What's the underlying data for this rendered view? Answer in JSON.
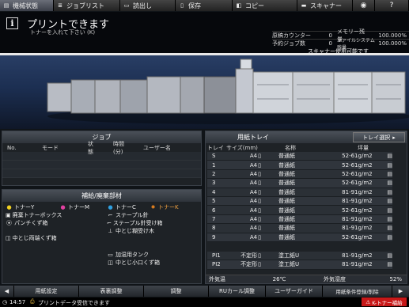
{
  "tabs": [
    {
      "label": "機械状態",
      "icon": "machine-status-icon",
      "active": true
    },
    {
      "label": "ジョブリスト",
      "icon": "job-list-icon",
      "active": false
    },
    {
      "label": "読出し",
      "icon": "retrieve-icon",
      "active": false
    },
    {
      "label": "保存",
      "icon": "save-icon",
      "active": false
    },
    {
      "label": "コピー",
      "icon": "copy-icon",
      "active": false
    },
    {
      "label": "スキャナー",
      "icon": "scanner-icon",
      "active": false
    }
  ],
  "status": {
    "title": "プリントできます",
    "subtitle": "トナーを入れて下さい (K)",
    "counters": [
      {
        "label": "原稿カウンター",
        "value": "0",
        "label2": "メモリー残量",
        "value2": "100.000%"
      },
      {
        "label": "予約ジョブ数",
        "value": "0",
        "label2": "ファイルシステム残量",
        "value2": "100.000%"
      }
    ],
    "scanner_status": "スキャナー使用可能です"
  },
  "jobs": {
    "title": "ジョブ",
    "columns": [
      "No.",
      "モード",
      "状態",
      "時間(分)",
      "ユーザー名"
    ]
  },
  "supplies": {
    "title": "補給/廃棄部材",
    "col1": [
      {
        "label": "トナーY",
        "color": "#f0d020",
        "icon": "toner-y-icon"
      },
      {
        "label": "廃棄トナーボックス",
        "color": "#cccccc",
        "icon": "waste-toner-box-icon"
      },
      {
        "label": "パンチくず箱",
        "color": "#cccccc",
        "icon": "punch-waste-icon"
      },
      {
        "label": "中とじ両端くず箱",
        "color": "#cccccc",
        "icon": "trim-waste-icon"
      }
    ],
    "col2": [
      {
        "label": "トナーM",
        "color": "#e040a0",
        "icon": "toner-m-icon"
      }
    ],
    "col3": [
      {
        "label": "トナーC",
        "color": "#30a0e0",
        "icon": "toner-c-icon"
      },
      {
        "label": "ステープル針",
        "color": "#cccccc",
        "icon": "staple-icon"
      },
      {
        "label": "ステープル針受け箱",
        "color": "#cccccc",
        "icon": "staple-waste-icon"
      },
      {
        "label": "中とじ糊受け木",
        "color": "#cccccc",
        "icon": "glue-tray-icon"
      },
      {
        "label": "加湿用タンク",
        "color": "#cccccc",
        "icon": "humidifier-tank-icon"
      },
      {
        "label": "中とじ小口くず箱",
        "color": "#cccccc",
        "icon": "fore-edge-waste-icon"
      }
    ],
    "col4": [
      {
        "label": "トナーK",
        "color": "#e08020",
        "icon": "toner-k-warning-icon"
      }
    ]
  },
  "trays": {
    "title": "用紙トレイ",
    "select_label": "トレイ選択",
    "columns": [
      "トレイ",
      "サイズ(mm)",
      "名称",
      "坪量"
    ],
    "rows": [
      {
        "tray": "S",
        "size": "A4",
        "name": "普通紙",
        "weight": "52-61g/m2"
      },
      {
        "tray": "1",
        "size": "A4",
        "name": "普通紙",
        "weight": "52-61g/m2"
      },
      {
        "tray": "2",
        "size": "A4",
        "name": "普通紙",
        "weight": "52-61g/m2"
      },
      {
        "tray": "3",
        "size": "A4",
        "name": "普通紙",
        "weight": "52-61g/m2"
      },
      {
        "tray": "4",
        "size": "A4",
        "name": "普通紙",
        "weight": "81-91g/m2"
      },
      {
        "tray": "5",
        "size": "A4",
        "name": "普通紙",
        "weight": "81-91g/m2"
      },
      {
        "tray": "6",
        "size": "A4",
        "name": "普通紙",
        "weight": "52-61g/m2"
      },
      {
        "tray": "7",
        "size": "A4",
        "name": "普通紙",
        "weight": "81-91g/m2"
      },
      {
        "tray": "8",
        "size": "A4",
        "name": "普通紙",
        "weight": "81-91g/m2"
      },
      {
        "tray": "9",
        "size": "A4",
        "name": "普通紙",
        "weight": "52-61g/m2"
      }
    ],
    "extra_rows": [
      {
        "tray": "PI1",
        "size": "不定形",
        "name": "塗工紙U",
        "weight": "81-91g/m2"
      },
      {
        "tray": "PI2",
        "size": "不定形",
        "name": "塗工紙U",
        "weight": "81-91g/m2"
      }
    ],
    "outside_temp_label": "外気温",
    "outside_temp_value": "26℃",
    "outside_humidity_label": "外気湿度",
    "outside_humidity_value": "52%"
  },
  "bottom_tabs": [
    "用紙設定",
    "表裏調整",
    "調整",
    "RUカール調整",
    "ユーザーガイド",
    "用紙条件登録/削除"
  ],
  "footer": {
    "time": "14:57",
    "message": "プリントデータ受信できます",
    "warning": "K-トナー補給"
  }
}
